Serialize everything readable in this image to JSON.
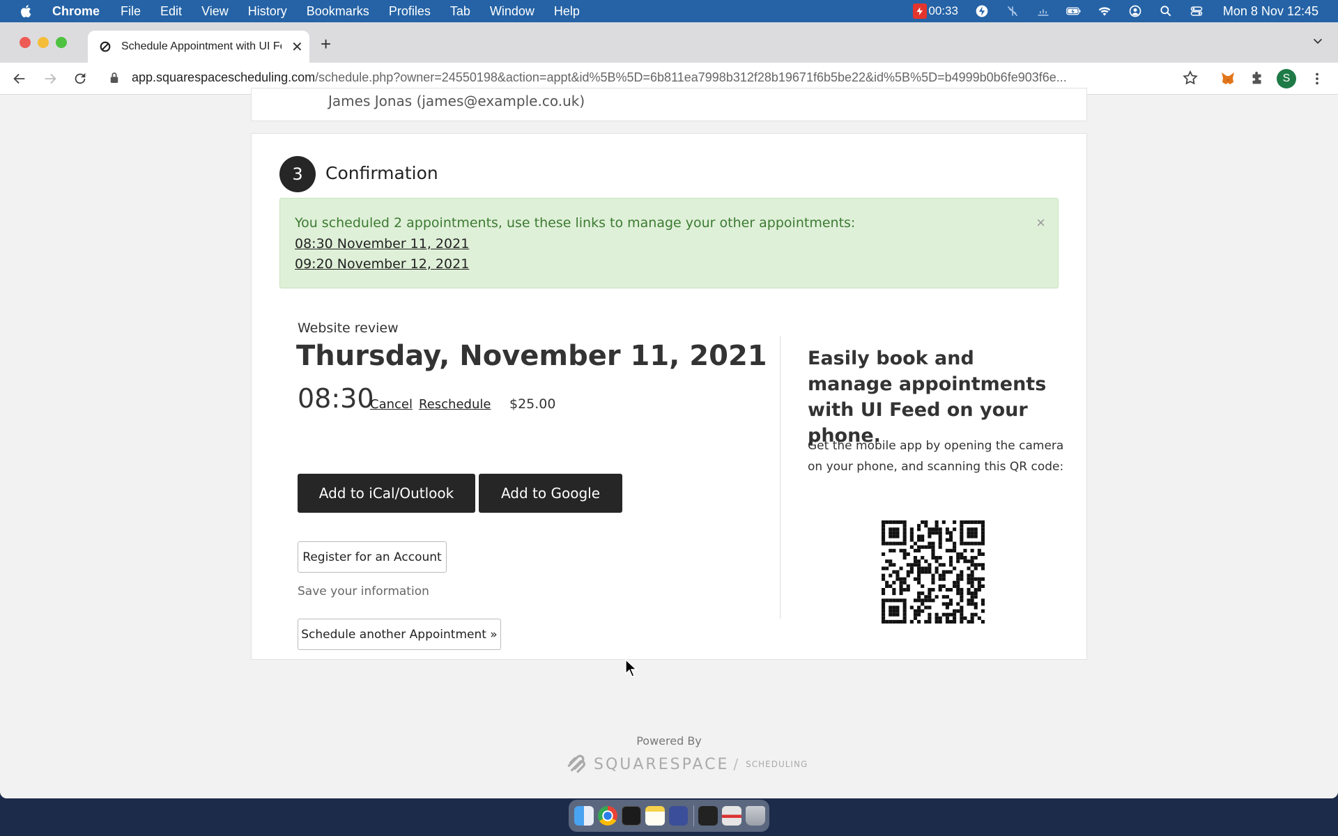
{
  "menubar": {
    "app_name": "Chrome",
    "menus": [
      "File",
      "Edit",
      "View",
      "History",
      "Bookmarks",
      "Profiles",
      "Tab",
      "Window",
      "Help"
    ],
    "timer": "00:33",
    "datetime": "Mon 8 Nov  12:45",
    "status_icons": [
      "bolt-icon",
      "mute-icon",
      "network-icon",
      "battery-icon",
      "wifi-icon",
      "user-icon",
      "spotlight-icon",
      "control-center-icon"
    ]
  },
  "browser": {
    "tab_title": "Schedule Appointment with UI Feed",
    "url_host": "app.squarespacescheduling.com",
    "url_path": "/schedule.php?owner=24550198&action=appt&id%5B%5D=6b811ea7998b312f28b19671f6b5be22&id%5B%5D=b4999b0b6fe903f6e...",
    "profile_initial": "S"
  },
  "page": {
    "previous_section_text": "James Jonas (james@example.co.uk)",
    "step_number": "3",
    "step_title": "Confirmation",
    "alert": {
      "message": "You scheduled 2 appointments, use these links to manage your other appointments:",
      "links": [
        "08:30 November 11, 2021",
        "09:20 November 12, 2021"
      ],
      "dismiss": "×"
    },
    "appointment": {
      "type": "Website review",
      "date": "Thursday, November 11, 2021",
      "time": "08:30",
      "cancel_label": "Cancel",
      "reschedule_label": "Reschedule",
      "price": "$25.00"
    },
    "buttons": {
      "ical": "Add to iCal/Outlook",
      "google": "Add to Google",
      "register": "Register for an Account",
      "save_info": "Save your information",
      "another": "Schedule another Appointment »"
    },
    "promo": {
      "heading": "Easily book and manage appointments with UI Feed on your phone.",
      "text": "Get the mobile app by opening the camera on your phone, and scanning this QR code:"
    },
    "footer": {
      "powered_by": "Powered By",
      "brand": "SQUARESPACE",
      "sub": "SCHEDULING",
      "slash": "/"
    }
  },
  "colors": {
    "menubar": "#2563a6",
    "alert_bg": "#dff0d8",
    "alert_text": "#3c7a32",
    "button_dark": "#262626"
  }
}
